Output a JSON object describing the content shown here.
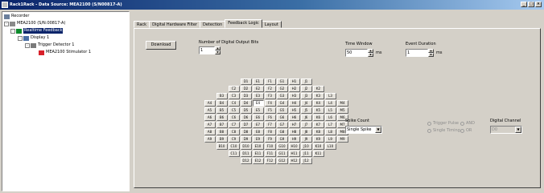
{
  "window": {
    "title": "Rack1Rack - Data Source: MEA2100 (S/N00817-A)",
    "buttons": [
      "_",
      "□",
      "×"
    ]
  },
  "tree": {
    "items": [
      {
        "label": "Recorder",
        "toggle": "",
        "icon": "recorder-icon"
      },
      {
        "label": "MEA2100 (S/N:00817-A)",
        "toggle": "-",
        "icon": "device-icon"
      },
      {
        "label": "Realtime Feedback",
        "toggle": "-",
        "icon": "feedback-icon",
        "selected": true
      },
      {
        "label": "Display 1",
        "toggle": "-",
        "icon": "display-icon"
      },
      {
        "label": "Trigger Detector 1",
        "toggle": "-",
        "icon": "trigger-icon"
      },
      {
        "label": "MEA2100 Stimulator 1",
        "toggle": "",
        "icon": "stimulator-icon"
      }
    ]
  },
  "tabs": [
    {
      "label": "Rack"
    },
    {
      "label": "Digital Hardware Filter"
    },
    {
      "label": "Detection"
    },
    {
      "label": "Feedback Logic",
      "active": true
    },
    {
      "label": "Layout"
    }
  ],
  "feedback": {
    "download_label": "Download",
    "num_outputs_label": "Number of Digital Output Bits",
    "num_outputs_value": "1",
    "time_window_label": "Time Window",
    "time_window_value": "50",
    "time_window_unit": "ms",
    "event_duration_label": "Event Duration",
    "event_duration_value": "1",
    "event_duration_unit": "ms",
    "spike_count_label": "Spike Count",
    "spike_count_value": "Single Spike",
    "radios": [
      {
        "label": "Trigger Pulse"
      },
      {
        "label": "Single Timing"
      },
      {
        "label": "AND"
      },
      {
        "label": "OR"
      }
    ],
    "digital_channel_label": "Digital Channel",
    "digital_channel_value": "D0"
  },
  "electrode_grid": [
    [
      "D1",
      "E1",
      "F1",
      "G1",
      "H1",
      "J1"
    ],
    [
      "C2",
      "D2",
      "E2",
      "F2",
      "G2",
      "H2",
      "J2",
      "K2"
    ],
    [
      "B3",
      "C3",
      "D3",
      "E3",
      "F3",
      "G3",
      "H3",
      "J3",
      "K3",
      "L3"
    ],
    [
      "A4",
      "B4",
      "C4",
      "D4",
      "E4",
      "F4",
      "G4",
      "H4",
      "J4",
      "K4",
      "L4",
      "M4"
    ],
    [
      "A5",
      "B5",
      "C5",
      "D5",
      "E5",
      "F5",
      "G5",
      "H5",
      "J5",
      "K5",
      "L5",
      "M5"
    ],
    [
      "A6",
      "B6",
      "C6",
      "D6",
      "E6",
      "F6",
      "G6",
      "H6",
      "J6",
      "K6",
      "L6",
      "M6"
    ],
    [
      "A7",
      "B7",
      "C7",
      "D7",
      "E7",
      "F7",
      "G7",
      "H7",
      "J7",
      "K7",
      "L7",
      "M7"
    ],
    [
      "A8",
      "B8",
      "C8",
      "D8",
      "E8",
      "F8",
      "G8",
      "H8",
      "J8",
      "K8",
      "L8",
      "M8"
    ],
    [
      "A9",
      "B9",
      "C9",
      "D9",
      "E9",
      "F9",
      "G9",
      "H9",
      "J9",
      "K9",
      "L9",
      "M9"
    ],
    [
      "B10",
      "C10",
      "D10",
      "E10",
      "F10",
      "G10",
      "H10",
      "J10",
      "K10",
      "L10"
    ],
    [
      "C11",
      "D11",
      "E11",
      "F11",
      "G11",
      "H11",
      "J11",
      "K11"
    ],
    [
      "D12",
      "E12",
      "F12",
      "G12",
      "H12",
      "J12"
    ]
  ],
  "selected_electrode": "E4"
}
